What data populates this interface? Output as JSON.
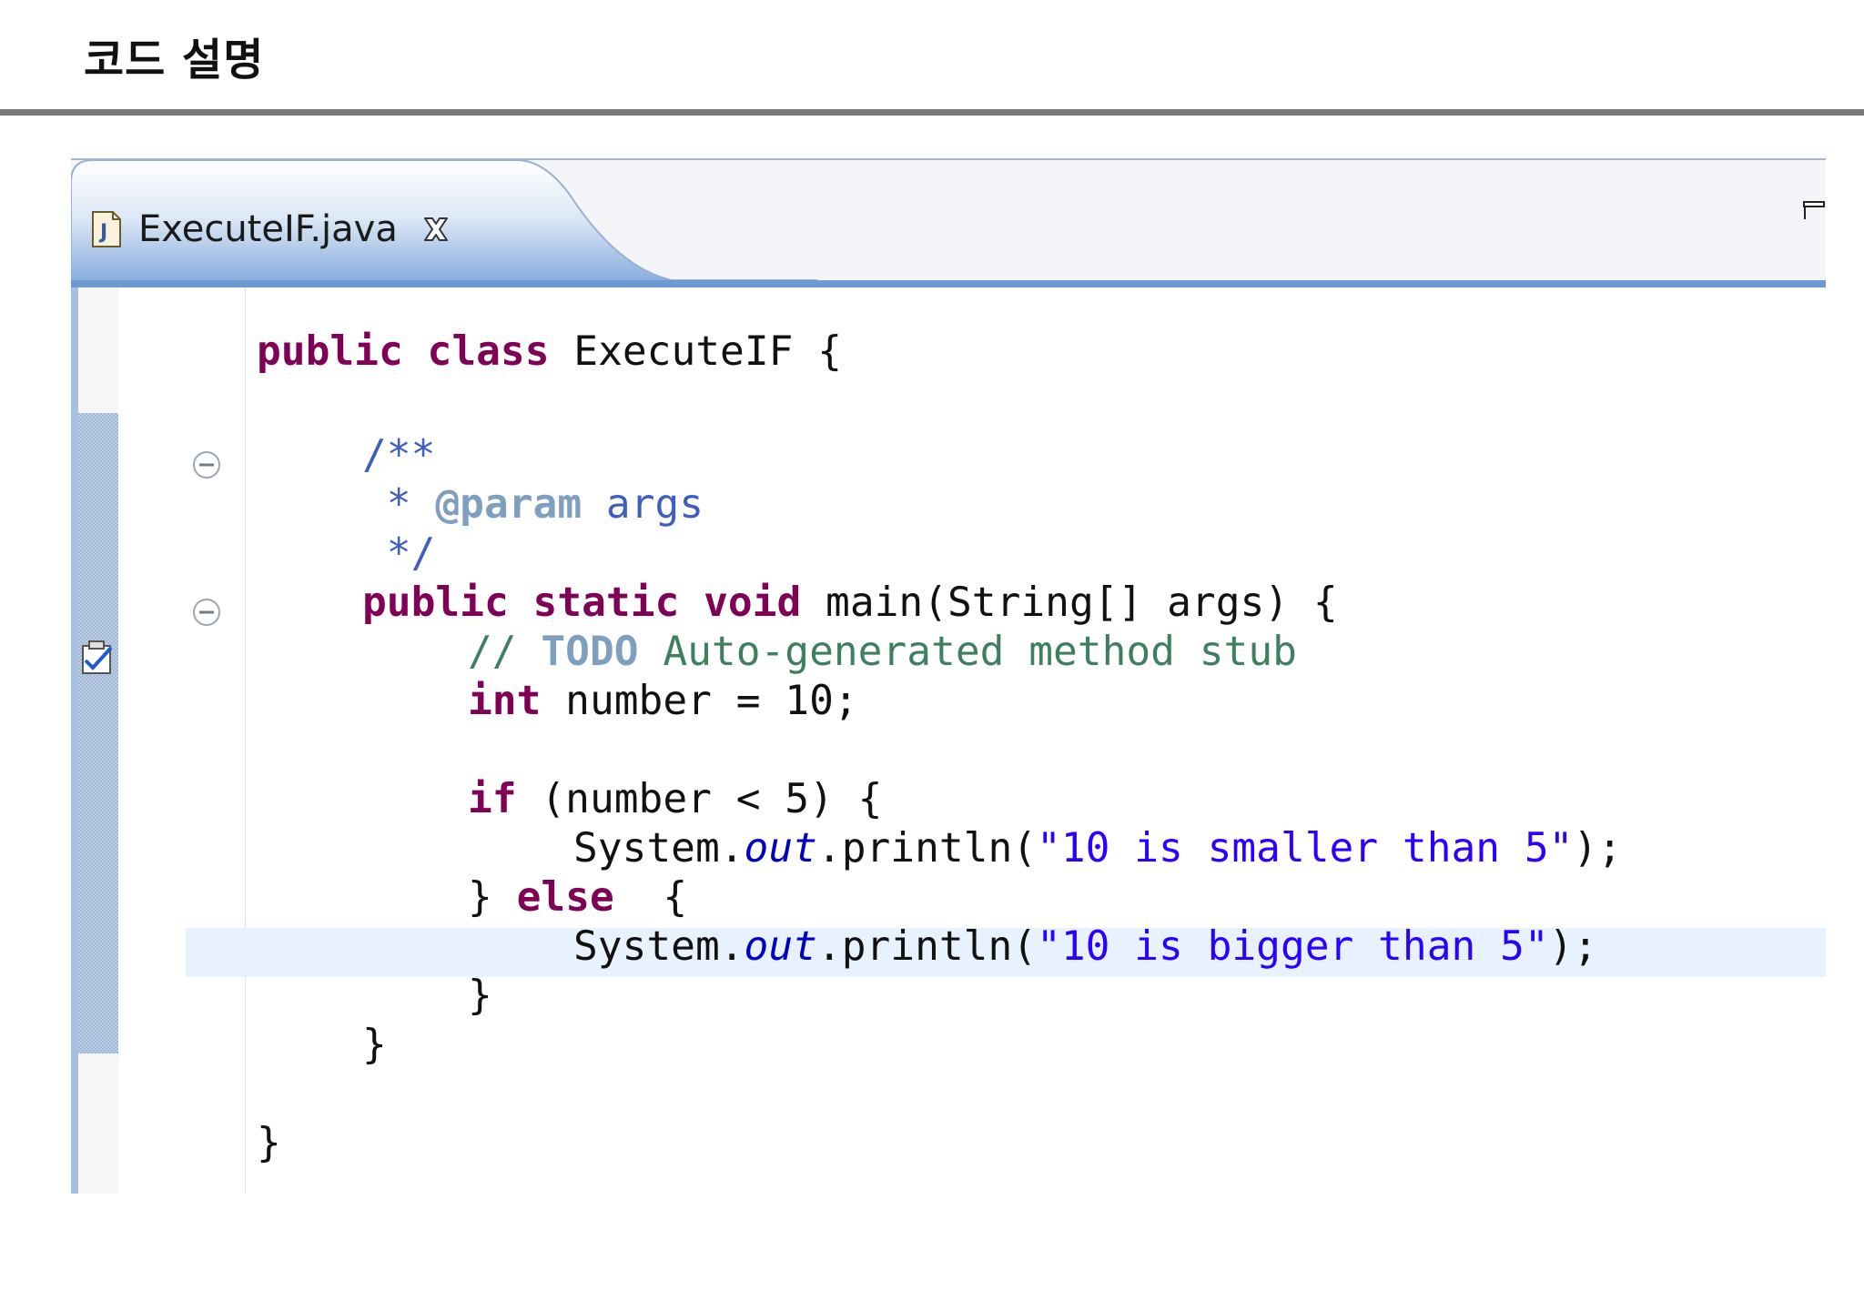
{
  "page": {
    "title": "코드 설명"
  },
  "editor": {
    "tab": {
      "label": "ExecuteIF.java",
      "file_icon": "java-file-icon",
      "close_icon": "close-icon"
    },
    "minimize_icon": "minimize-icon",
    "colors": {
      "keyword": "#7f0055",
      "javadoc": "#3f5fbf",
      "comment": "#3f7f5f",
      "string": "#2a00ff",
      "field": "#0000c0",
      "current_line": "#e8f2fe",
      "tab_strip_bottom": "#6e9ad3"
    },
    "current_line_number": 13,
    "code_tokens": {
      "l1_kw1": "public",
      "l1_kw2": "class",
      "l1_rest": " ExecuteIF {",
      "l3": "/**",
      "l4_star": " * ",
      "l4_tag": "@param",
      "l4_rest": " args",
      "l5": " */",
      "l6_kw1": "public",
      "l6_kw2": "static",
      "l6_kw3": "void",
      "l6_rest": " main(String[] args) {",
      "l7_slashes": "// ",
      "l7_todo": "TODO",
      "l7_rest": " Auto-generated method stub",
      "l8_kw": "int",
      "l8_rest": " number = 10;",
      "l10_kw": "if",
      "l10_rest": " (number < 5) {",
      "l11_pre": "System.",
      "l11_field": "out",
      "l11_mid": ".println(",
      "l11_str": "\"10 is smaller than 5\"",
      "l11_end": ");",
      "l12_pre": "} ",
      "l12_kw": "else",
      "l12_rest": "  {",
      "l13_pre": "System.",
      "l13_field": "out",
      "l13_mid": ".println(",
      "l13_str": "\"10 is bigger than 5\"",
      "l13_end": ");",
      "l14": "}",
      "l15": "}",
      "l17": "}"
    }
  }
}
